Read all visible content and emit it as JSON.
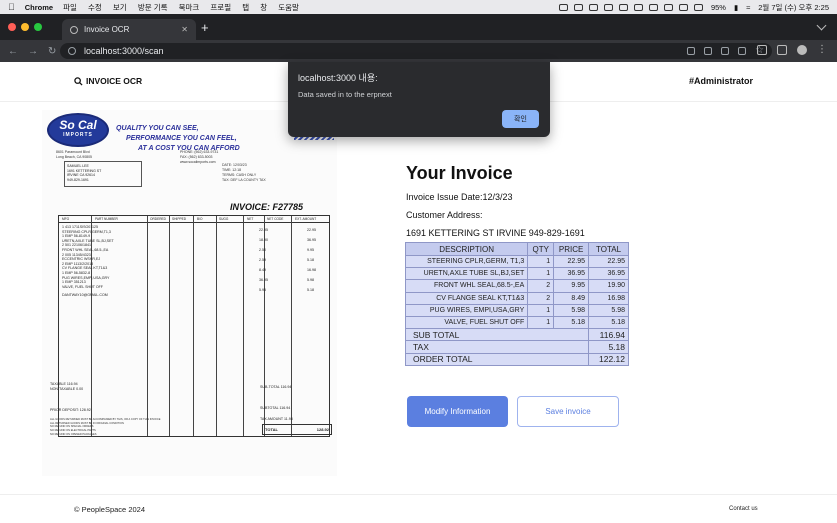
{
  "os_menubar": {
    "app": "Chrome",
    "menus": [
      "파일",
      "수정",
      "보기",
      "방문 기록",
      "북마크",
      "프로필",
      "탭",
      "창",
      "도움말"
    ],
    "battery": "95%",
    "clock": "2월 7일 (수) 오후 2:25"
  },
  "browser": {
    "tab_title": "Invoice OCR",
    "url": "localhost:3000/scan"
  },
  "app": {
    "brand": "INVOICE OCR",
    "user": "#Administrator"
  },
  "alert": {
    "title": "localhost:3000 내용:",
    "message": "Data saved in to the erpnext",
    "ok_label": "확인"
  },
  "receipt": {
    "logo_top": "So Cal",
    "logo_bottom": "IMPORTS",
    "slogan": [
      "QUALITY YOU CAN SEE,",
      "PERFORMANCE YOU CAN FEEL,",
      "AT A COST YOU CAN AFFORD"
    ],
    "address": [
      "8601 Paramount Blvd",
      "Long Beach, CA 90805"
    ],
    "header_info": [
      "PHONE: (562) 633-9731",
      "FAX: (562) 633-5003",
      "www.socalimports.com"
    ],
    "meta": [
      "DATE: 12/03/23",
      "TIME: 12:18",
      "TERMS: CASH ONLY",
      "TAX: DEF LA COUNTY TAX"
    ],
    "bill_to": [
      "SAMUEL LEE",
      "1691 KETTERING ST",
      "IRVINE          CA 92614",
      "949-829-1691"
    ],
    "invoice_number": "INVOICE: F27785",
    "columns": [
      "MFG",
      "PART NUMBER",
      "ORDERED",
      "SHIPPED",
      "B/O",
      "SUGG",
      "NET",
      "NET CODE",
      "EXT. AMOUNT"
    ],
    "line_items": [
      "1 413  1711SISO01125",
      "  STEERING CPLR,GERM,T1,3",
      "1 EMP  56-8149-9",
      "  URETN,AXLE TUBE SL,BJ,SET",
      "2 501  22106/1841",
      "  FRONT WHL SEAL,68.5-,EA",
      "2 005  11345/4323",
      "  ECCENTRIC WSHR,EJ",
      "2 EMP  1113/2/2018",
      "  CV FLANGE SEAL KT,T1&3",
      "1 EMP  56-5832-8",
      "  PUG WIRES,EMPI,USA,GRY",
      "1 EMP  351213",
      "  VALVE, FUEL SHUT OFF"
    ],
    "net_prices": [
      "22.95",
      "18.90",
      "2.50",
      "2.59",
      "8.49",
      "36.95",
      "5.95"
    ],
    "ext_amounts": [
      "22.95",
      "36.95",
      "9.95",
      "5.18",
      "16.98",
      "5.98",
      "5.18"
    ],
    "email": "DANTWAY10@GMAIL.COM",
    "taxable": "TAXABLE          116.94",
    "nontaxable": "NON-TAXABLE       0.00",
    "prior_deposit": "PRIOR DEPOSIT: 128.92",
    "subtotal_label": "SUB-TOTAL          116.94",
    "subtotal2": "SUBTOTAL           116.94",
    "tax_amount": "TAX AMOUNT           11.98",
    "total_label": "TOTAL",
    "total_value": "128.92",
    "fine_print": [
      "ALL GOODS RETURNED MUST BE ACCOMPANIED BY THIS, OR A COPY OF THIS INVOICE",
      "ALL RETURNED GOODS MUST BE IN ORIGINAL CONDITION",
      "NO REFUND ON SPECIAL ORDERS",
      "NO REFUND ON ELECTRICAL PARTS",
      "NO REFUND ON OPENED PACKAGES"
    ]
  },
  "invoice": {
    "title": "Your Invoice",
    "issue_date": "Invoice Issue Date:12/3/23",
    "address_label": "Customer Address:",
    "address_value": "1691 KETTERING ST IRVINE 949-829-1691",
    "headers": [
      "DESCRIPTION",
      "QTY",
      "PRICE",
      "TOTAL"
    ],
    "rows": [
      {
        "description": "STEERING CPLR,GERM, T1,3",
        "qty": "1",
        "price": "22.95",
        "total": "22.95"
      },
      {
        "description": "URETN,AXLE TUBE SL,BJ,SET",
        "qty": "1",
        "price": "36.95",
        "total": "36.95"
      },
      {
        "description": "FRONT WHL SEAL,68.5-,EA",
        "qty": "2",
        "price": "9.95",
        "total": "19.90"
      },
      {
        "description": "CV FLANGE SEAL KT,T1&3",
        "qty": "2",
        "price": "8.49",
        "total": "16.98"
      },
      {
        "description": "PUG WIRES, EMPI,USA,GRY",
        "qty": "1",
        "price": "5.98",
        "total": "5.98"
      },
      {
        "description": "VALVE, FUEL SHUT OFF",
        "qty": "1",
        "price": "5.18",
        "total": "5.18"
      }
    ],
    "summary": [
      {
        "label": "SUB TOTAL",
        "value": "116.94"
      },
      {
        "label": "TAX",
        "value": "5.18"
      },
      {
        "label": "ORDER TOTAL",
        "value": "122.12"
      }
    ],
    "modify_label": "Modify Information",
    "save_label": "Save invoice"
  },
  "footer": {
    "copyright": "© PeopleSpace 2024",
    "contact": "Contact us"
  },
  "colors": {
    "primary": "#5b7fe0",
    "table_bg": "#d7dcf6",
    "table_head": "#c4cbee",
    "dialog_bg": "#2a2b2e",
    "dialog_button": "#8ab4f8"
  }
}
